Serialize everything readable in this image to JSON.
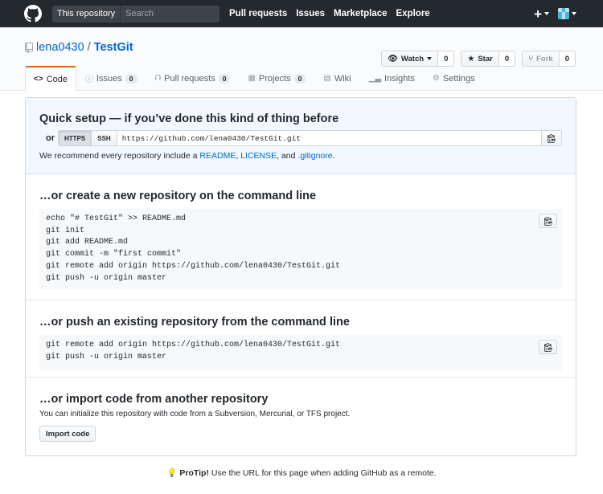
{
  "header": {
    "search_scope": "This repository",
    "search_placeholder": "Search",
    "nav": [
      "Pull requests",
      "Issues",
      "Marketplace",
      "Explore"
    ],
    "plus": "+"
  },
  "repo": {
    "owner": "lena0430",
    "separator": "/",
    "name": "TestGit",
    "actions": {
      "watch": {
        "label": "Watch",
        "count": "0"
      },
      "star": {
        "label": "Star",
        "count": "0"
      },
      "fork": {
        "label": "Fork",
        "count": "0"
      }
    },
    "tabs": [
      {
        "label": "Code",
        "icon": "code-icon"
      },
      {
        "label": "Issues",
        "count": "0",
        "icon": "issue-icon"
      },
      {
        "label": "Pull requests",
        "count": "0",
        "icon": "pull-request-icon"
      },
      {
        "label": "Projects",
        "count": "0",
        "icon": "project-icon"
      },
      {
        "label": "Wiki",
        "icon": "book-icon"
      },
      {
        "label": "Insights",
        "icon": "graph-icon"
      },
      {
        "label": "Settings",
        "icon": "gear-icon"
      }
    ]
  },
  "quick_setup": {
    "title": "Quick setup — if you’ve done this kind of thing before",
    "or": "or",
    "https": "HTTPS",
    "ssh": "SSH",
    "url": "https://github.com/lena0430/TestGit.git",
    "recommend_prefix": "We recommend every repository include a ",
    "readme": "README",
    "comma1": ", ",
    "license": "LICENSE",
    "and": ", and ",
    "gitignore": ".gitignore",
    "period": "."
  },
  "create_new": {
    "title": "…or create a new repository on the command line",
    "lines": [
      "echo \"# TestGit\" >> README.md",
      "git init",
      "git add README.md",
      "git commit -m \"first commit\"",
      "git remote add origin https://github.com/lena0430/TestGit.git",
      "git push -u origin master"
    ]
  },
  "push_existing": {
    "title": "…or push an existing repository from the command line",
    "lines": [
      "git remote add origin https://github.com/lena0430/TestGit.git",
      "git push -u origin master"
    ]
  },
  "import": {
    "title": "…or import code from another repository",
    "description": "You can initialize this repository with code from a Subversion, Mercurial, or TFS project.",
    "button": "Import code"
  },
  "protip": {
    "label": "ProTip!",
    "text": " Use the URL for this page when adding GitHub as a remote."
  }
}
